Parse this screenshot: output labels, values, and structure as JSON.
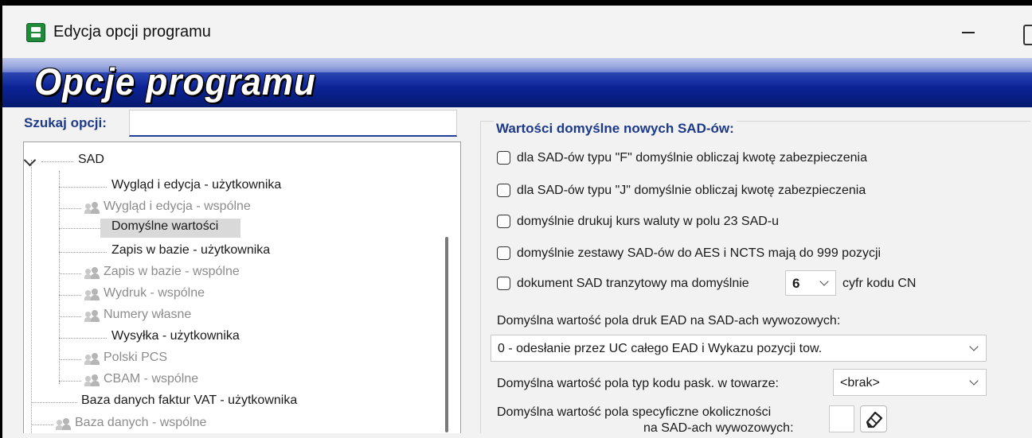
{
  "window": {
    "title": "Edycja opcji programu"
  },
  "banner": {
    "title": "Opcje programu"
  },
  "search": {
    "label": "Szukaj opcji:",
    "value": "",
    "placeholder": ""
  },
  "tree": {
    "root_label": "SAD",
    "items": [
      {
        "label": "Wygląd i edycja - użytkownika",
        "dim": false,
        "icon": "none"
      },
      {
        "label": "Wygląd i edycja - wspólne",
        "dim": true,
        "icon": "users-icon"
      },
      {
        "label": "Domyślne wartości",
        "dim": false,
        "icon": "none",
        "selected": true
      },
      {
        "label": "Zapis w bazie - użytkownika",
        "dim": false,
        "icon": "none"
      },
      {
        "label": "Zapis w bazie - wspólne",
        "dim": true,
        "icon": "users-icon"
      },
      {
        "label": "Wydruk - wspólne",
        "dim": true,
        "icon": "users-icon"
      },
      {
        "label": "Numery własne",
        "dim": true,
        "icon": "users-icon"
      },
      {
        "label": "Wysyłka - użytkownika",
        "dim": false,
        "icon": "none"
      },
      {
        "label": "Polski PCS",
        "dim": true,
        "icon": "users-icon"
      },
      {
        "label": "CBAM - wspólne",
        "dim": true,
        "icon": "users-icon"
      }
    ],
    "top_items": [
      {
        "label": "Baza danych faktur VAT - użytkownika",
        "dim": false,
        "icon": "none"
      },
      {
        "label": "Baza danych - wspólne",
        "dim": true,
        "icon": "users-icon"
      }
    ]
  },
  "options": {
    "section_title": "Wartości domyślne nowych SAD-ów:",
    "checkboxes": [
      {
        "label": "dla SAD-ów typu \"F\" domyślnie obliczaj kwotę zabezpieczenia",
        "checked": false
      },
      {
        "label": "dla SAD-ów typu \"J\" domyślnie obliczaj kwotę zabezpieczenia",
        "checked": false
      },
      {
        "label": "domyślnie drukuj kurs waluty w polu 23 SAD-u",
        "checked": false
      },
      {
        "label": "domyślnie zestawy SAD-ów do AES i NCTS mają do 999 pozycji",
        "checked": false
      }
    ],
    "transit": {
      "label_before": "dokument SAD tranzytowy ma domyślnie",
      "digits_value": "6",
      "label_after": "cyfr kodu CN",
      "checked": false
    },
    "ead_label": "Domyślna wartość pola druk EAD na SAD-ach wywozowych:",
    "ead_value": "0 - odesłanie przez UC całego EAD i Wykazu pozycji tow.",
    "barcode_label": "Domyślna wartość pola typ kodu pask. w towarze:",
    "barcode_value": "<brak>",
    "circumstances_label_line1": "Domyślna wartość pola specyficzne okoliczności",
    "circumstances_label_line2": "na SAD-ach wywozowych:",
    "circumstances_value": ""
  },
  "colors": {
    "banner_blue": "#0b2296",
    "section_title": "#1d3a8a",
    "app_icon": "#1f8a3a"
  }
}
